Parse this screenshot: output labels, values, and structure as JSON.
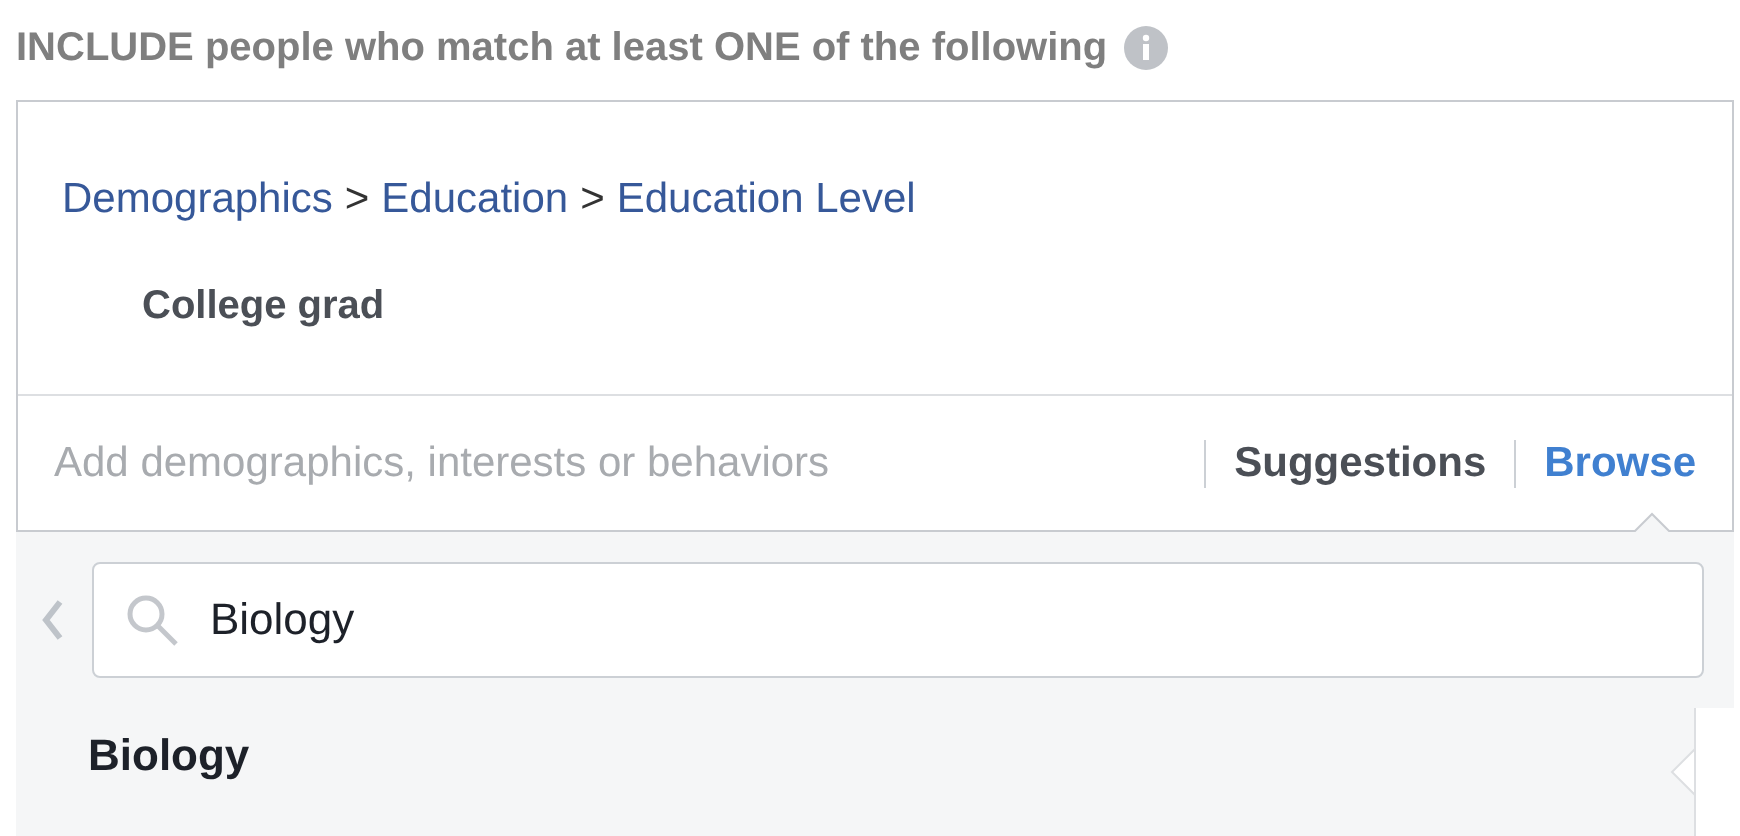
{
  "heading": "INCLUDE people who match at least ONE of the following",
  "breadcrumb": [
    "Demographics",
    "Education",
    "Education Level"
  ],
  "separator": ">",
  "selected_items": [
    "College grad"
  ],
  "add_field": {
    "placeholder": "Add demographics, interests or behaviors"
  },
  "tabs": [
    {
      "label": "Suggestions",
      "selected": false
    },
    {
      "label": "Browse",
      "selected": true
    }
  ],
  "browse_search": {
    "value": "Biology"
  },
  "results": [
    {
      "label": "Biology",
      "selected": true
    }
  ]
}
